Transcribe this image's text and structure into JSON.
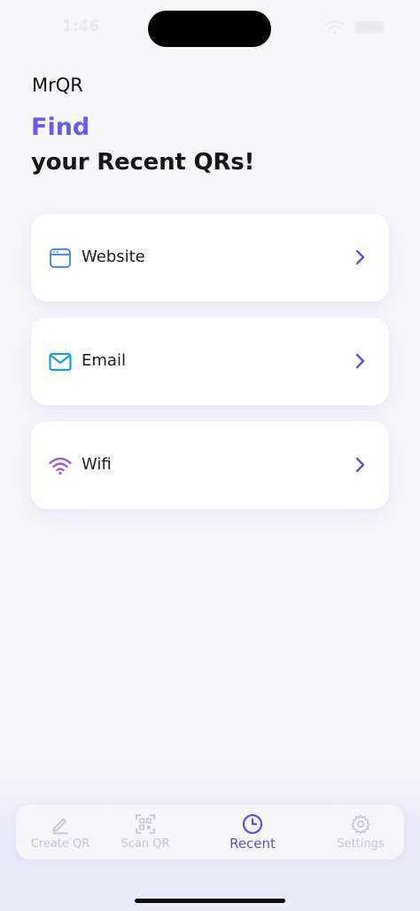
{
  "status": {
    "time": "1:46"
  },
  "app": {
    "title": "MrQR"
  },
  "headline": {
    "accent": "Find",
    "main": "your Recent QRs!"
  },
  "categories": [
    {
      "label": "Website",
      "icon": "browser-window-icon"
    },
    {
      "label": "Email",
      "icon": "envelope-icon"
    },
    {
      "label": "Wifi",
      "icon": "wifi-icon"
    }
  ],
  "tabs": [
    {
      "label": "Create QR",
      "icon": "pencil-icon",
      "active": false
    },
    {
      "label": "Scan QR",
      "icon": "qr-scan-icon",
      "active": false
    },
    {
      "label": "Recent",
      "icon": "clock-icon",
      "active": true
    },
    {
      "label": "Settings",
      "icon": "gear-icon",
      "active": false
    }
  ],
  "colors": {
    "accent": "#6a5be8",
    "active_tab": "#5b52d6",
    "inactive_tab": "#c6c6d2",
    "website_icon": "#4a8fe0",
    "email_icon": "#1d9be0",
    "wifi_icon": "#9b59d6",
    "chevron": "#5b52d6"
  }
}
